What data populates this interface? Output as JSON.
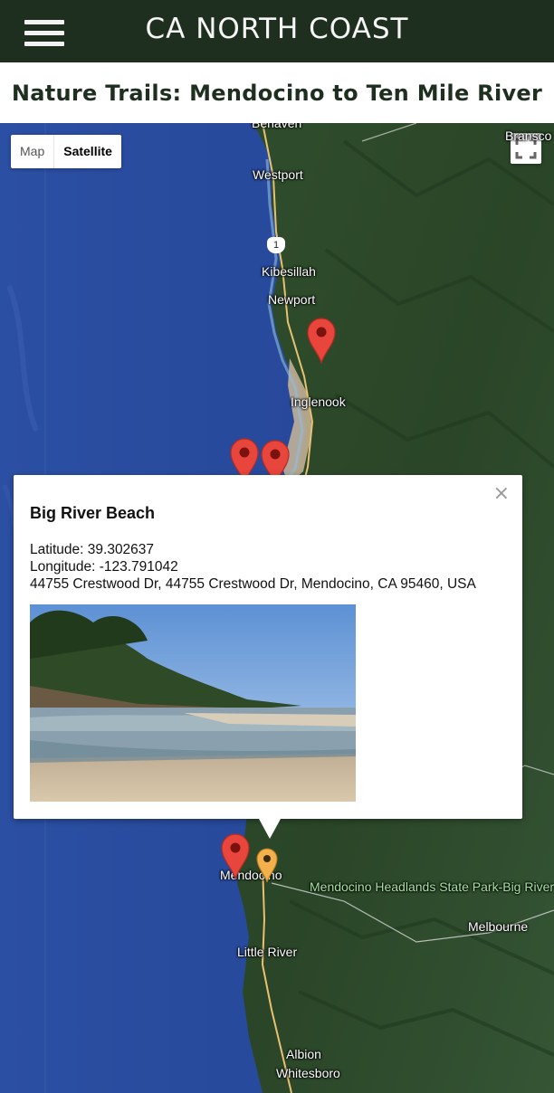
{
  "header": {
    "site_title": "CA NORTH COAST",
    "menu_icon": "hamburger-menu-icon"
  },
  "page": {
    "title": "Nature Trails: Mendocino to Ten Mile River"
  },
  "map": {
    "type_control": {
      "map_label": "Map",
      "satellite_label": "Satellite",
      "selected": "Satellite"
    },
    "fullscreen_icon": "fullscreen-icon",
    "route_shield": "1",
    "labels": {
      "bennett": "Benaven",
      "branscomb": "Bransco",
      "westport": "Westport",
      "kibesillah": "Kibesillah",
      "newport": "Newport",
      "inglenook": "Inglenook",
      "mendocino": "Mendocino",
      "park": "Mendocino Headlands State Park-Big River Property",
      "melbourne": "Melbourne",
      "little_river": "Little River",
      "albion": "Albion",
      "whitesboro": "Whitesboro"
    },
    "colors": {
      "marker_red": "#e8453c",
      "marker_selected": "#f4b14b",
      "ocean": "#27489a",
      "land": "#2d4a2a"
    }
  },
  "info_window": {
    "title": "Big River Beach",
    "latitude": "Latitude: 39.302637",
    "longitude": "Longitude: -123.791042",
    "address": "44755 Crestwood Dr, 44755 Crestwood Dr, Mendocino, CA 95460, USA",
    "close_icon": "close-icon",
    "close_glyph": "×",
    "photo": "beach-photo"
  }
}
